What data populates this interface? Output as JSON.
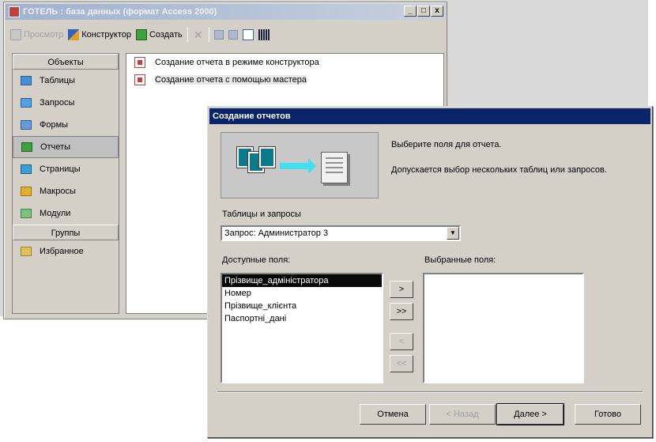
{
  "main_window": {
    "title": "ГОТЕЛЬ : база данных (формат Access 2000)",
    "buttons": [
      "_",
      "□",
      "x"
    ],
    "toolbar": {
      "preview": "Просмотр",
      "design": "Конструктор",
      "create": "Создать"
    },
    "objects_header": "Объекты",
    "objects": [
      "Таблицы",
      "Запросы",
      "Формы",
      "Отчеты",
      "Страницы",
      "Макросы",
      "Модули"
    ],
    "groups_header": "Группы",
    "groups": [
      "Избранное"
    ],
    "list": [
      "Создание отчета в режиме конструктора",
      "Создание отчета с помощью мастера"
    ]
  },
  "dialog": {
    "title": "Создание отчетов",
    "instruction1": "Выберите поля для отчета.",
    "instruction2": "Допускается выбор нескольких таблиц или запросов.",
    "tables_label": "Таблицы и запросы",
    "combo_value": "Запрос: Администратор 3",
    "available_label": "Доступные поля:",
    "selected_label": "Выбранные поля:",
    "available_fields": [
      "Прізвище_адміністратора",
      "Номер",
      "Прізвище_клієнта",
      "Паспортні_дані"
    ],
    "selected_fields": [],
    "move_buttons": [
      ">",
      ">>",
      "<",
      "<<"
    ],
    "buttons": {
      "cancel": "Отмена",
      "back": "< Назад",
      "next": "Далее >",
      "finish": "Готово"
    }
  }
}
